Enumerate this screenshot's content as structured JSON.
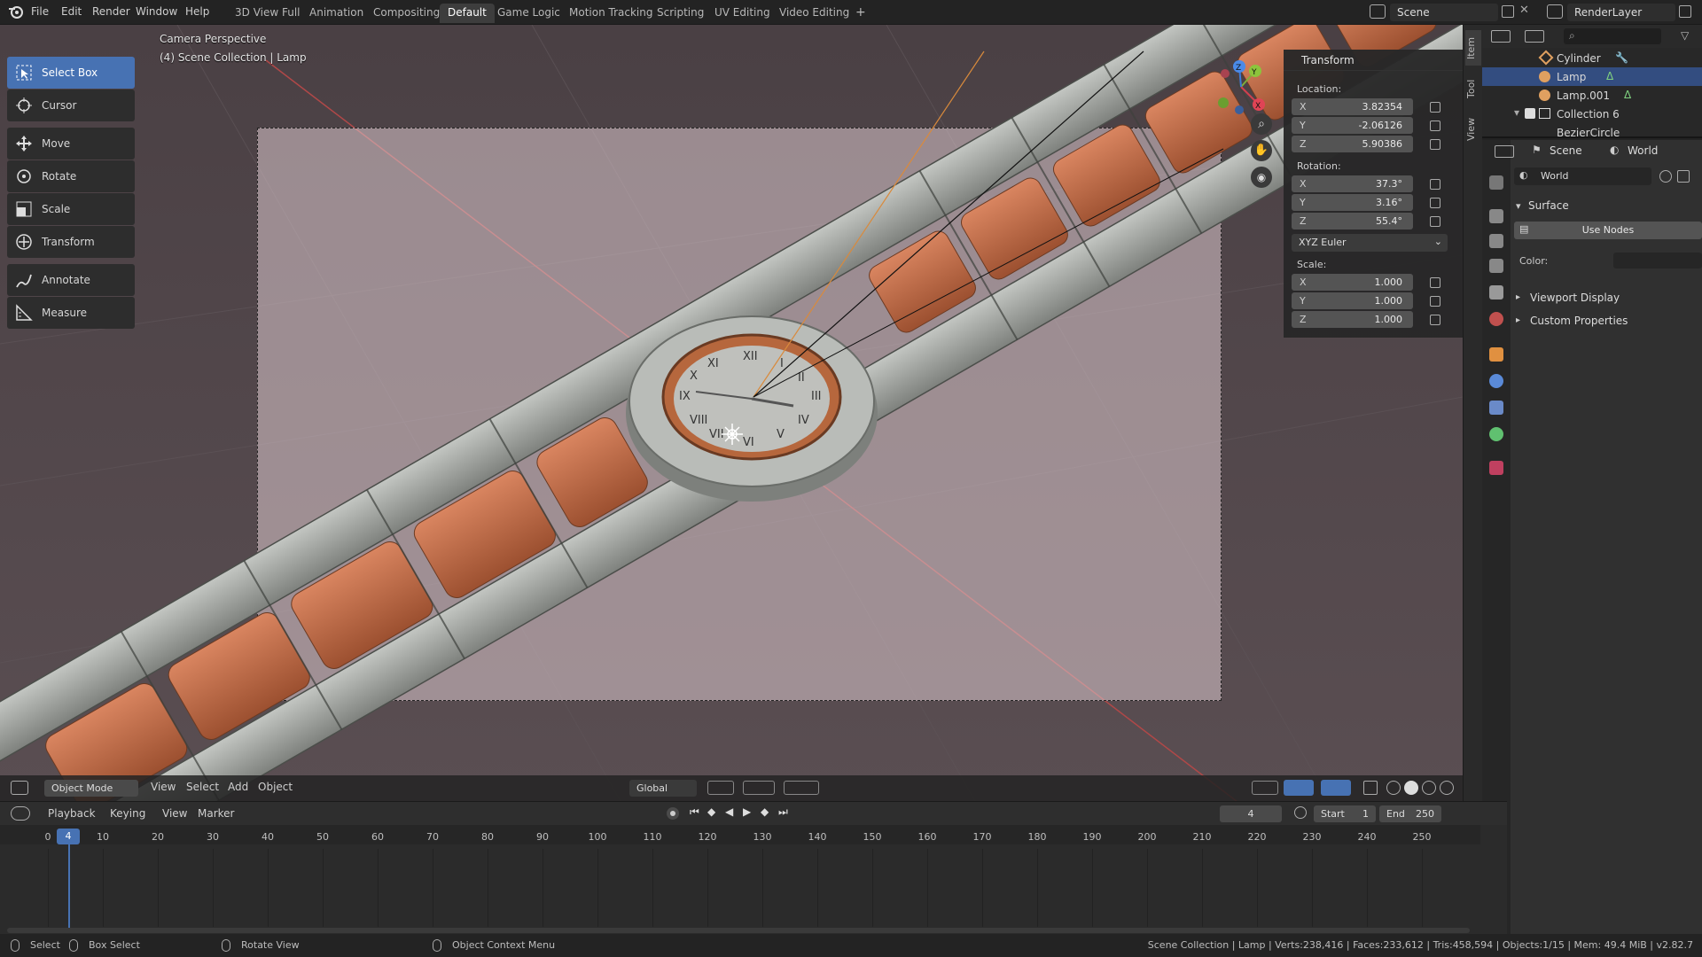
{
  "topbar": {
    "menus": [
      "File",
      "Edit",
      "Render",
      "Window",
      "Help"
    ],
    "workspaces": [
      "3D View Full",
      "Animation",
      "Compositing",
      "Default",
      "Game Logic",
      "Motion Tracking",
      "Scripting",
      "UV Editing",
      "Video Editing"
    ],
    "active_workspace": "Default",
    "add_tab": "+",
    "scene_name": "Scene",
    "render_layer": "RenderLayer"
  },
  "viewport": {
    "view_name": "Camera Perspective",
    "collection_info": "(4) Scene Collection | Lamp",
    "gizmo": {
      "x": "X",
      "y": "Y",
      "z": "Z"
    }
  },
  "toolbar": {
    "tools": [
      "Select Box",
      "Cursor",
      "Move",
      "Rotate",
      "Scale",
      "Transform",
      "Annotate",
      "Measure"
    ],
    "active": "Select Box"
  },
  "npanel": {
    "title": "Transform",
    "location_label": "Location:",
    "location": [
      {
        "axis": "X",
        "value": "3.82354"
      },
      {
        "axis": "Y",
        "value": "-2.06126"
      },
      {
        "axis": "Z",
        "value": "5.90386"
      }
    ],
    "rotation_label": "Rotation:",
    "rotation": [
      {
        "axis": "X",
        "value": "37.3°"
      },
      {
        "axis": "Y",
        "value": "3.16°"
      },
      {
        "axis": "Z",
        "value": "55.4°"
      }
    ],
    "rotation_mode": "XYZ Euler",
    "scale_label": "Scale:",
    "scale": [
      {
        "axis": "X",
        "value": "1.000"
      },
      {
        "axis": "Y",
        "value": "1.000"
      },
      {
        "axis": "Z",
        "value": "1.000"
      }
    ],
    "side_tabs": [
      "Item",
      "Tool",
      "View"
    ]
  },
  "outliner": {
    "rows": [
      {
        "name": "Cylinder",
        "selected": false
      },
      {
        "name": "Lamp",
        "selected": true
      },
      {
        "name": "Lamp.001",
        "selected": false
      },
      {
        "name": "Collection 6",
        "selected": false
      },
      {
        "name": "BezierCircle",
        "selected": false
      }
    ]
  },
  "properties": {
    "scene_tab": "Scene",
    "world_tab": "World",
    "world_name": "World",
    "surface_label": "Surface",
    "use_nodes_button": "Use Nodes",
    "color_label": "Color:",
    "viewport_display": "Viewport Display",
    "custom_properties": "Custom Properties"
  },
  "viewport_header": {
    "mode": "Object Mode",
    "menus": [
      "View",
      "Select",
      "Add",
      "Object"
    ],
    "orientation": "Global"
  },
  "timeline": {
    "menus": [
      "Playback",
      "Keying",
      "View",
      "Marker"
    ],
    "current_frame": "4",
    "start_label": "Start",
    "start": "1",
    "end_label": "End",
    "end": "250",
    "ruler": [
      "0",
      "10",
      "20",
      "30",
      "40",
      "50",
      "60",
      "70",
      "80",
      "90",
      "100",
      "110",
      "120",
      "130",
      "140",
      "150",
      "160",
      "170",
      "180",
      "190",
      "200",
      "210",
      "220",
      "230",
      "240",
      "250"
    ]
  },
  "statusbar": {
    "select": "Select",
    "box_select": "Box Select",
    "rotate_view": "Rotate View",
    "context_menu": "Object Context Menu",
    "stats": "Scene Collection | Lamp | Verts:238,416 | Faces:233,612 | Tris:458,594 | Objects:1/15 | Mem: 49.4 MiB | v2.82.7"
  },
  "colors": {
    "accent": "#4772b3",
    "selection": "#334d80",
    "band": "#c8704a",
    "metal": "#a7aaa6",
    "backdrop": "#514549"
  }
}
